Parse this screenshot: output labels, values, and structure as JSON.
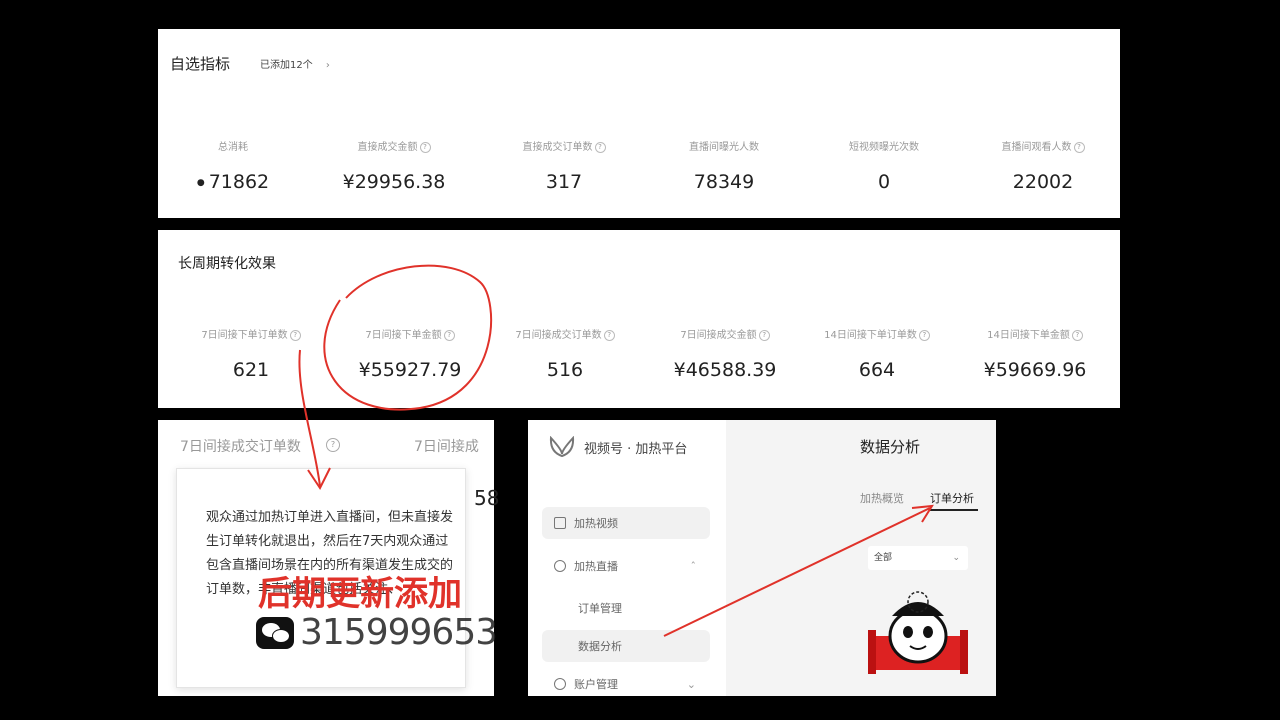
{
  "panel1": {
    "title": "自选指标",
    "added": "已添加12个",
    "metrics": [
      {
        "label": "总消耗",
        "value": "71862",
        "icon": "coin-icon"
      },
      {
        "label": "直接成交金额",
        "value": "¥29956.38"
      },
      {
        "label": "直接成交订单数",
        "value": "317"
      },
      {
        "label": "直播间曝光人数",
        "value": "78349"
      },
      {
        "label": "短视频曝光次数",
        "value": "0"
      },
      {
        "label": "直播间观看人数",
        "value": "22002"
      }
    ]
  },
  "panel2": {
    "title": "长周期转化效果",
    "metrics": [
      {
        "label": "7日间接下单订单数",
        "value": "621"
      },
      {
        "label": "7日间接下单金额",
        "value": "¥55927.79"
      },
      {
        "label": "7日间接成交订单数",
        "value": "516"
      },
      {
        "label": "7日间接成交金额",
        "value": "¥46588.39"
      },
      {
        "label": "14日间接下单订单数",
        "value": "664"
      },
      {
        "label": "14日间接下单金额",
        "value": "¥59669.96"
      }
    ]
  },
  "tooltip_panel": {
    "header1": "7日间接成交订单数",
    "header2": "7日间接成",
    "partial_value": "58",
    "tip_text": "观众通过加热订单进入直播间，但未直接发生订单转化就退出，然后在7天内观众通过包含直播间场景在内的所有渠道发生成交的订单数，非直播间渠道包括关注、"
  },
  "overlay": {
    "update_text": "后期更新添加",
    "wechat_id": "315999653"
  },
  "platform": {
    "logo_text": "视频号 · 加热平台",
    "page_title": "数据分析",
    "tabs": [
      "加热概览",
      "订单分析"
    ],
    "active_tab": 1,
    "filter": "全部",
    "sidebar": [
      {
        "label": "加热视频",
        "icon": "video-icon"
      },
      {
        "label": "加热直播",
        "icon": "live-icon"
      },
      {
        "label": "订单管理"
      },
      {
        "label": "数据分析"
      },
      {
        "label": "账户管理",
        "icon": "user-icon"
      }
    ]
  },
  "colors": {
    "annotation_red": "#e0322a",
    "background": "#000000"
  }
}
